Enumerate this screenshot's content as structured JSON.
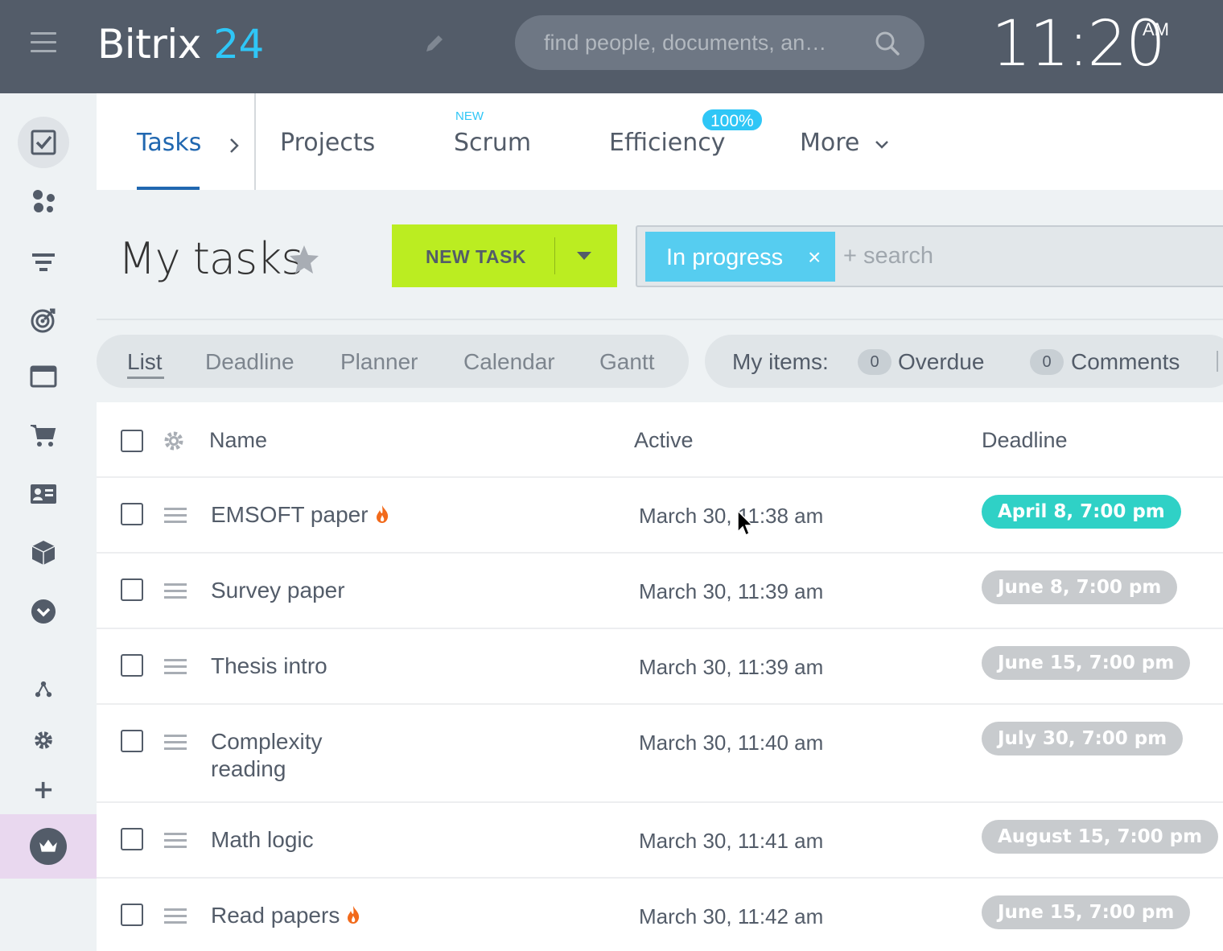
{
  "header": {
    "logo_text": "Bitrix",
    "logo_num": "24",
    "search_placeholder": "find people, documents, an…",
    "clock_time": "11:20",
    "clock_ampm": "AM",
    "icons": [
      "menu-icon",
      "pencil-icon",
      "search-icon"
    ]
  },
  "sidebar": {
    "icons": [
      "tasks-icon",
      "groups-icon",
      "funnel-icon",
      "target-icon",
      "sites-icon",
      "cart-icon",
      "contact-card-icon",
      "box-icon",
      "expand-more-icon",
      "flow-icon",
      "settings-icon",
      "add-icon",
      "crown-icon"
    ]
  },
  "tabs": {
    "items": [
      {
        "label": "Tasks",
        "active": true
      },
      {
        "label": "Projects"
      },
      {
        "label": "Scrum",
        "badge": "NEW"
      },
      {
        "label": "Efficiency",
        "badge": "100%"
      },
      {
        "label": "More"
      }
    ]
  },
  "toolbar": {
    "page_title": "My tasks",
    "new_task_label": "NEW TASK",
    "filter_chip": "In progress",
    "filter_chip_close": "×",
    "filter_search_placeholder": "+ search"
  },
  "views": {
    "items": [
      "List",
      "Deadline",
      "Planner",
      "Calendar",
      "Gantt"
    ],
    "active": "List"
  },
  "counters": {
    "label": "My items:",
    "items": [
      {
        "count": "0",
        "label": "Overdue"
      },
      {
        "count": "0",
        "label": "Comments"
      }
    ]
  },
  "grid": {
    "columns": [
      "Name",
      "Active",
      "Deadline"
    ],
    "rows": [
      {
        "name": "EMSOFT paper",
        "hot": true,
        "active": "March 30, 11:38 am",
        "deadline": "April 8, 7:00 pm",
        "deadline_status": "upcoming"
      },
      {
        "name": "Survey paper",
        "hot": false,
        "active": "March 30, 11:39 am",
        "deadline": "June 8, 7:00 pm",
        "deadline_status": "later"
      },
      {
        "name": "Thesis intro",
        "hot": false,
        "active": "March 30, 11:39 am",
        "deadline": "June 15, 7:00 pm",
        "deadline_status": "later"
      },
      {
        "name_line1": "Complexity",
        "name_line2": "reading",
        "hot": false,
        "active": "March 30, 11:40 am",
        "deadline": "July 30, 7:00 pm",
        "deadline_status": "later"
      },
      {
        "name": "Math logic",
        "hot": false,
        "active": "March 30, 11:41 am",
        "deadline": "August 15, 7:00 pm",
        "deadline_status": "later"
      },
      {
        "name": "Read papers",
        "hot": true,
        "active": "March 30, 11:42 am",
        "deadline": "June 15, 7:00 pm",
        "deadline_status": "later"
      }
    ]
  },
  "colors": {
    "header_bg": "#535c69",
    "brand_blue": "#2fc6f6",
    "new_task_green": "#bbed21",
    "filter_chip": "#56cdf0",
    "deadline_upcoming": "#2fd1c6",
    "deadline_later": "#c8cbce",
    "hot_flame": "#f26a1b"
  }
}
